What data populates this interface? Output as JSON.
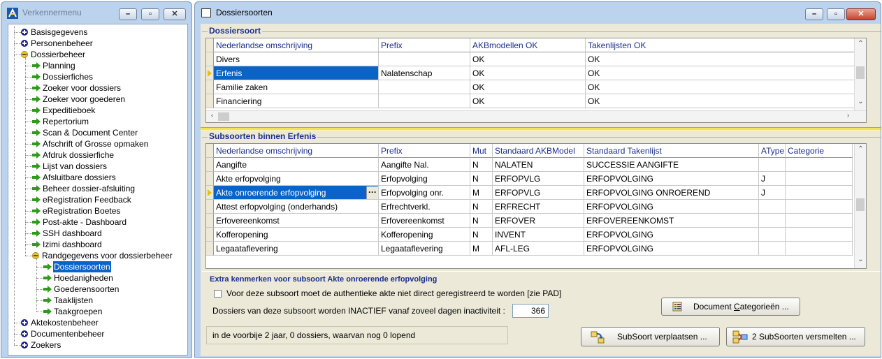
{
  "left_window": {
    "title": "Verkennermenu",
    "tree": [
      {
        "label": "Basisgegevens",
        "icon": "plus",
        "level": 0
      },
      {
        "label": "Personenbeheer",
        "icon": "plus",
        "level": 0
      },
      {
        "label": "Dossierbeheer",
        "icon": "minus",
        "level": 0
      },
      {
        "label": "Planning",
        "icon": "arrow",
        "level": 1
      },
      {
        "label": "Dossierfiches",
        "icon": "arrow",
        "level": 1
      },
      {
        "label": "Zoeker voor dossiers",
        "icon": "arrow",
        "level": 1
      },
      {
        "label": "Zoeker voor goederen",
        "icon": "arrow",
        "level": 1
      },
      {
        "label": "Expeditieboek",
        "icon": "arrow",
        "level": 1
      },
      {
        "label": "Repertorium",
        "icon": "arrow",
        "level": 1
      },
      {
        "label": "Scan & Document Center",
        "icon": "arrow",
        "level": 1
      },
      {
        "label": "Afschrift of Grosse opmaken",
        "icon": "arrow",
        "level": 1
      },
      {
        "label": "Afdruk dossierfiche",
        "icon": "arrow",
        "level": 1
      },
      {
        "label": "Lijst van dossiers",
        "icon": "arrow",
        "level": 1
      },
      {
        "label": "Afsluitbare dossiers",
        "icon": "arrow",
        "level": 1
      },
      {
        "label": "Beheer dossier-afsluiting",
        "icon": "arrow",
        "level": 1
      },
      {
        "label": "eRegistration Feedback",
        "icon": "arrow",
        "level": 1
      },
      {
        "label": "eRegistration Boetes",
        "icon": "arrow",
        "level": 1
      },
      {
        "label": "Post-akte - Dashboard",
        "icon": "arrow",
        "level": 1
      },
      {
        "label": "SSH dashboard",
        "icon": "arrow",
        "level": 1
      },
      {
        "label": "Izimi dashboard",
        "icon": "arrow",
        "level": 1
      },
      {
        "label": "Randgegevens voor dossierbeheer",
        "icon": "minus",
        "level": 1
      },
      {
        "label": "Dossiersoorten",
        "icon": "arrow",
        "level": 2,
        "selected": true
      },
      {
        "label": "Hoedanigheden",
        "icon": "arrow",
        "level": 2
      },
      {
        "label": "Goederensoorten",
        "icon": "arrow",
        "level": 2
      },
      {
        "label": "Taaklijsten",
        "icon": "arrow",
        "level": 2
      },
      {
        "label": "Taakgroepen",
        "icon": "arrow",
        "level": 2
      },
      {
        "label": "Aktekostenbeheer",
        "icon": "plus",
        "level": 0
      },
      {
        "label": "Documentenbeheer",
        "icon": "plus",
        "level": 0
      },
      {
        "label": "Zoekers",
        "icon": "plus",
        "level": 0
      }
    ]
  },
  "main_window": {
    "title": "Dossiersoorten",
    "dossiersoort": {
      "group_title": "Dossiersoort",
      "columns": [
        "Nederlandse omschrijving",
        "Prefix",
        "AKBmodellen OK",
        "Takenlijsten OK"
      ],
      "rows": [
        [
          "Divers",
          "",
          "OK",
          "OK"
        ],
        [
          "Erfenis",
          "Nalatenschap",
          "OK",
          "OK"
        ],
        [
          "Familie zaken",
          "",
          "OK",
          "OK"
        ],
        [
          "Financiering",
          "",
          "OK",
          "OK"
        ]
      ],
      "current_row": 1
    },
    "subsoorten": {
      "group_title": "Subsoorten binnen Erfenis",
      "columns": [
        "Nederlandse omschrijving",
        "Prefix",
        "Mut",
        "Standaard AKBModel",
        "Standaard Takenlijst",
        "AType",
        "Categorie"
      ],
      "rows": [
        [
          "Aangifte",
          "Aangifte Nal.",
          "N",
          "NALATEN",
          "SUCCESSIE AANGIFTE",
          "",
          ""
        ],
        [
          "Akte erfopvolging",
          "Erfopvolging",
          "N",
          "ERFOPVLG",
          "ERFOPVOLGING",
          "J",
          ""
        ],
        [
          "Akte onroerende erfopvolging",
          "Erfopvolging onr.",
          "M",
          "ERFOPVLG",
          "ERFOPVOLGING ONROEREND",
          "J",
          ""
        ],
        [
          "Attest erfopvolging (onderhands)",
          "Erfrechtverkl.",
          "N",
          "ERFRECHT",
          "ERFOPVOLGING",
          "",
          ""
        ],
        [
          "Erfovereenkomst",
          "Erfovereenkomst",
          "N",
          "ERFOVER",
          "ERFOVEREENKOMST",
          "",
          ""
        ],
        [
          "Kofferopening",
          "Kofferopening",
          "N",
          "INVENT",
          "ERFOPVOLGING",
          "",
          ""
        ],
        [
          "Legaataflevering",
          "Legaataflevering",
          "M",
          "AFL-LEG",
          "ERFOPVOLGING",
          "",
          ""
        ]
      ],
      "current_row": 2,
      "ellipsis": "···"
    },
    "extra": {
      "title": "Extra kenmerken voor subsoort Akte onroerende erfopvolging",
      "checkbox_label": "Voor deze subsoort moet de authentieke akte niet direct geregistreerd te worden [zie PAD]",
      "inactive_label": "Dossiers van deze subsoort worden INACTIEF vanaf zoveel dagen inactiviteit :",
      "inactive_days": "366",
      "doc_cat_button_pre": "Document ",
      "doc_cat_button_ul": "C",
      "doc_cat_button_post": "ategorieën ..."
    },
    "status_text": "in de voorbije 2 jaar, 0 dossiers, waarvan nog 0 lopend",
    "move_button": "SubSoort verplaatsen ...",
    "merge_button": "2 SubSoorten versmelten ..."
  }
}
